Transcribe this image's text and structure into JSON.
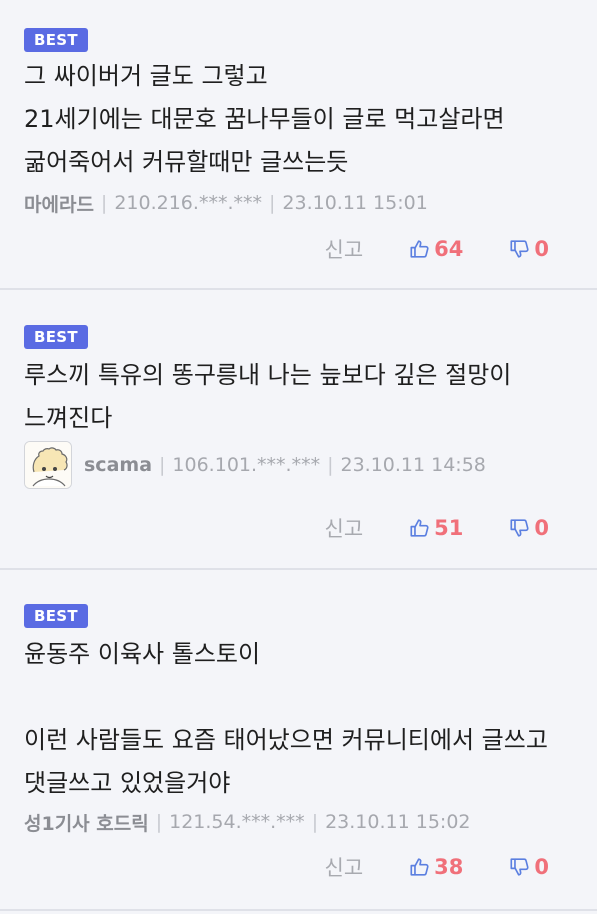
{
  "comments": [
    {
      "badge": "BEST",
      "text": "그 싸이버거 글도 그렇고\n21세기에는 대문호 꿈나무들이 글로 먹고살라면 굶어죽어서 커뮤할때만 글쓰는듯",
      "nickname": "마에라드",
      "ip": "210.216.***.***",
      "datetime": "23.10.11 15:01",
      "report_label": "신고",
      "upvotes": "64",
      "downvotes": "0"
    },
    {
      "badge": "BEST",
      "text": "루스끼 특유의 똥구릉내 나는 늪보다 깊은 절망이 느껴진다",
      "nickname": "scama",
      "ip": "106.101.***.***",
      "datetime": "23.10.11 14:58",
      "report_label": "신고",
      "upvotes": "51",
      "downvotes": "0"
    },
    {
      "badge": "BEST",
      "text": "윤동주 이육사 톨스토이\n\n이런 사람들도 요즘 태어났으면 커뮤니티에서 글쓰고 댓글쓰고 있었을거야",
      "nickname": "성1기사 호드릭",
      "ip": "121.54.***.***",
      "datetime": "23.10.11 15:02",
      "report_label": "신고",
      "upvotes": "38",
      "downvotes": "0"
    }
  ],
  "icons": {
    "upvote": "thumbs-up-icon",
    "downvote": "thumbs-down-icon"
  },
  "colors": {
    "background": "#f4f5f9",
    "badge": "#5a6be3",
    "vote_icon": "#5b7fe0",
    "vote_count": "#f0707a",
    "meta_text": "#a6a8ae"
  }
}
